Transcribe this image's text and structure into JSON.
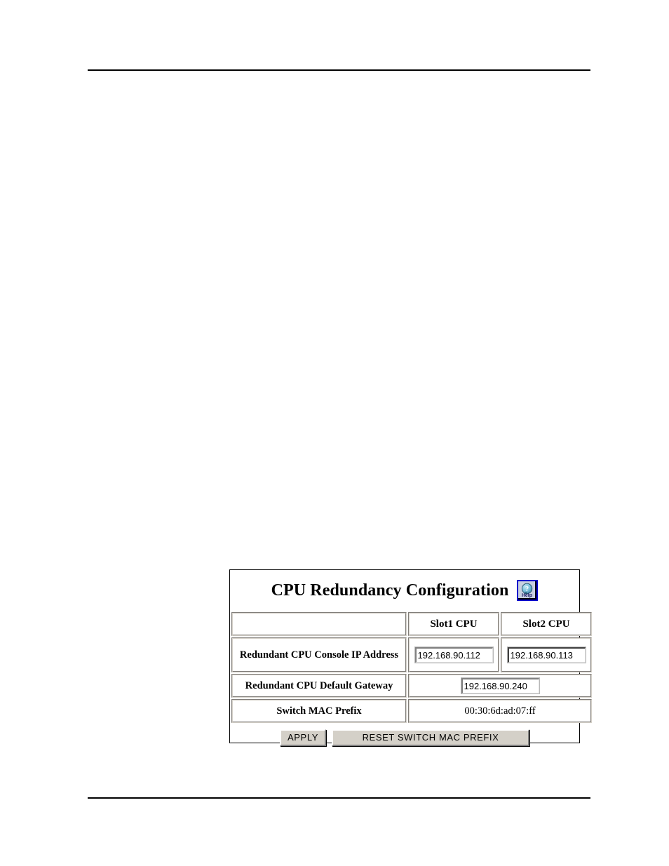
{
  "document": {
    "rules": [
      "top-hairline",
      "bottom-hairline"
    ]
  },
  "panel": {
    "title": "CPU Redundancy Configuration",
    "help": {
      "icon": "question-help-icon",
      "label": "Help",
      "border_color": "#0000cc",
      "face_color": "#c8d0e0"
    },
    "table": {
      "headers": [
        "",
        "Slot1 CPU",
        "Slot2 CPU"
      ],
      "rows": [
        {
          "label": "Redundant CPU Console IP Address",
          "type": "dual-input",
          "slot1_value": "192.168.90.112",
          "slot2_value": "192.168.90.113",
          "focused_field": "slot2"
        },
        {
          "label": "Redundant CPU Default Gateway",
          "type": "single-input",
          "value": "192.168.90.240"
        },
        {
          "label": "Switch MAC Prefix",
          "type": "static-text",
          "value": "00:30:6d:ad:07:ff"
        }
      ]
    },
    "buttons": {
      "apply": "APPLY",
      "reset": "RESET SWITCH MAC PREFIX"
    },
    "colors": {
      "button_face": "#d4d0c8",
      "panel_border": "#000000",
      "cell_border": "#d4d0c8",
      "text": "#000000"
    }
  }
}
